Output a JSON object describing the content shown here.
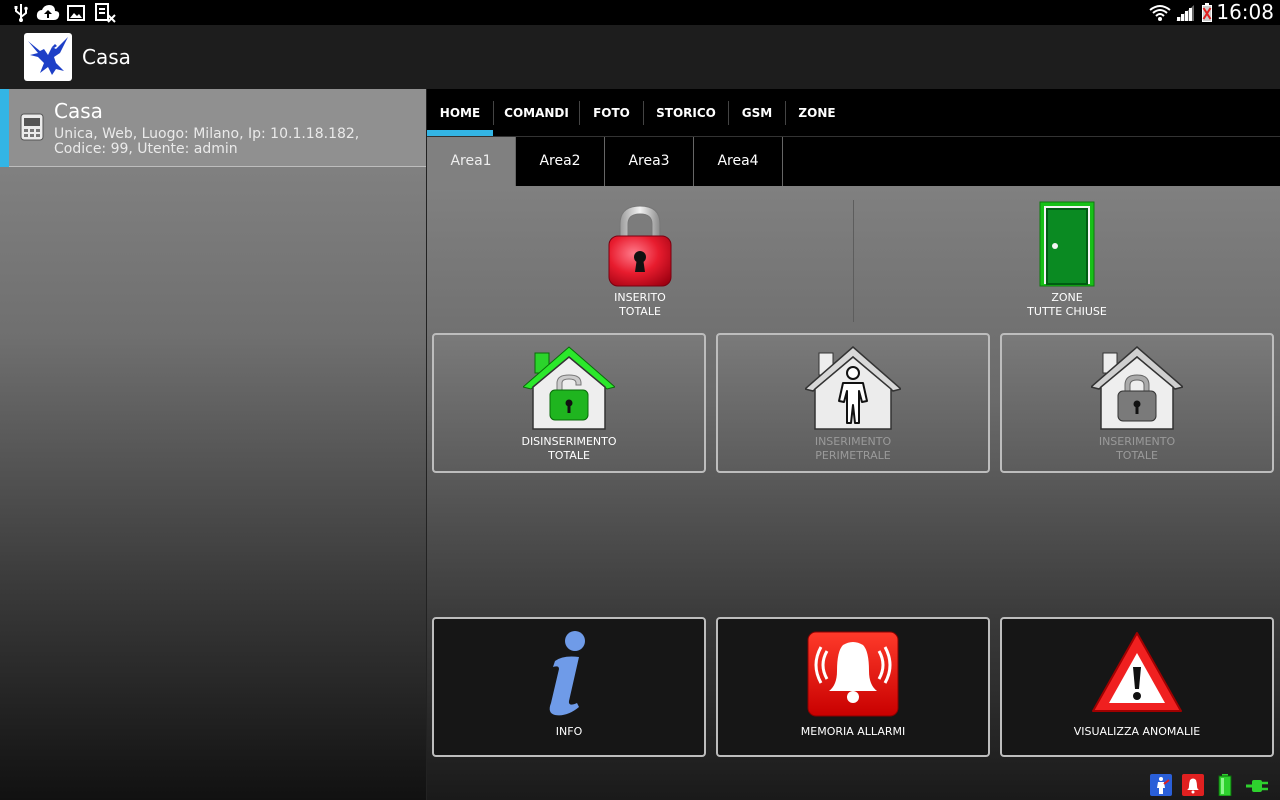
{
  "status_bar": {
    "clock": "16:08",
    "left_icons": [
      "usb-icon",
      "cloud-upload-icon",
      "image-icon",
      "sim-no-service-icon"
    ],
    "right_icons": [
      "wifi-icon",
      "signal-icon",
      "battery-low-icon"
    ]
  },
  "action_bar": {
    "title": "Casa",
    "logo_icon": "eagle-logo-icon"
  },
  "device": {
    "name": "Casa",
    "details": "Unica, Web, Luogo: Milano, Ip: 10.1.18.182, Codice: 99, Utente: admin",
    "accent_color": "#33b5e5"
  },
  "tabs": [
    {
      "label": "HOME",
      "active": true
    },
    {
      "label": "COMANDI"
    },
    {
      "label": "FOTO"
    },
    {
      "label": "STORICO"
    },
    {
      "label": "GSM"
    },
    {
      "label": "ZONE"
    }
  ],
  "areas": [
    {
      "label": "Area1",
      "active": true
    },
    {
      "label": "Area2"
    },
    {
      "label": "Area3"
    },
    {
      "label": "Area4"
    }
  ],
  "status": {
    "alarm": {
      "label": "INSERITO\nTOTALE",
      "icon": "red-padlock-icon"
    },
    "zones": {
      "label": "ZONE\nTUTTE CHIUSE",
      "icon": "green-door-icon"
    }
  },
  "commands": [
    {
      "label": "DISINSERIMENTO\nTOTALE",
      "icon": "house-unlocked-icon",
      "enabled": true
    },
    {
      "label": "INSERIMENTO\nPERIMETRALE",
      "icon": "house-person-icon",
      "enabled": false
    },
    {
      "label": "INSERIMENTO\nTOTALE",
      "icon": "house-locked-icon",
      "enabled": false
    },
    {
      "label": "INFO",
      "icon": "info-icon",
      "enabled": true
    },
    {
      "label": "MEMORIA ALLARMI",
      "icon": "alarm-bell-icon",
      "enabled": true
    },
    {
      "label": "VISUALIZZA ANOMALIE",
      "icon": "warning-icon",
      "enabled": true
    }
  ],
  "bottom_icons": [
    "tamper-icon",
    "alarm-status-icon",
    "battery-status-icon",
    "power-plug-icon"
  ]
}
